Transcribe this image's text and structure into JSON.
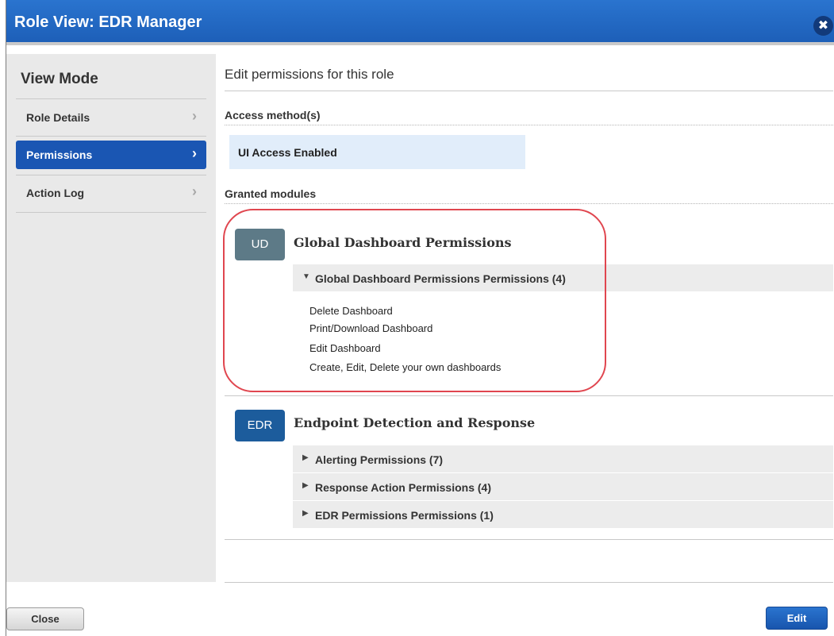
{
  "window": {
    "title": "Role View: EDR Manager",
    "close_icon": "✖"
  },
  "sidebar": {
    "heading": "View Mode",
    "items": [
      {
        "label": "Role Details",
        "chevron": "›"
      },
      {
        "label": "Permissions",
        "chevron": "›",
        "active": true
      },
      {
        "label": "Action Log",
        "chevron": "›"
      }
    ]
  },
  "main": {
    "heading": "Edit permissions for this role",
    "access_label": "Access method(s)",
    "access_value": "UI Access Enabled",
    "granted_label": "Granted modules",
    "modules": [
      {
        "badge": "UD",
        "name": "Global Dashboard Permissions",
        "groups": [
          {
            "label": "Global Dashboard Permissions Permissions (4)",
            "expanded": true,
            "arrow": "▼",
            "items": [
              "Delete Dashboard",
              "Print/Download Dashboard",
              "Edit Dashboard",
              "Create, Edit, Delete your own dashboards"
            ]
          }
        ]
      },
      {
        "badge": "EDR",
        "name": "Endpoint Detection and Response",
        "groups": [
          {
            "label": "Alerting Permissions (7)",
            "expanded": false,
            "arrow": "▶"
          },
          {
            "label": "Response Action Permissions (4)",
            "expanded": false,
            "arrow": "▶"
          },
          {
            "label": "EDR Permissions Permissions (1)",
            "expanded": false,
            "arrow": "▶"
          }
        ]
      }
    ]
  },
  "footer": {
    "close_label": "Close",
    "edit_label": "Edit"
  },
  "colors": {
    "title_bar": "#1d5fb8",
    "active_nav": "#1a56b3",
    "ud_badge": "#5d7a87",
    "edr_badge": "#1c5c9c",
    "highlight": "#e0464f",
    "access_box": "#e1edfa"
  }
}
